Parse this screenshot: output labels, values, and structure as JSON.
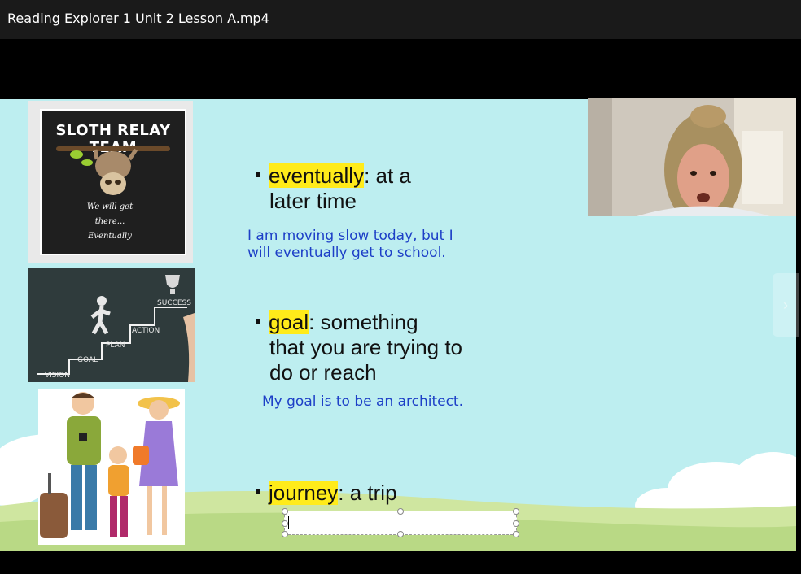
{
  "window": {
    "title": "Reading Explorer 1 Unit 2 Lesson A.mp4"
  },
  "slide": {
    "images": {
      "sloth": {
        "title": "SLOTH RELAY TEAM",
        "caption_line1": "We will get there...",
        "caption_line2": "Eventually"
      },
      "stairs": {
        "labels": [
          "VISION",
          "GOAL",
          "PLAN",
          "ACTION",
          "SUCCESS"
        ]
      }
    },
    "vocab": [
      {
        "word": "eventually",
        "definition_line1": ":   at a",
        "definition_line2": "later time",
        "example_line1": "I am moving slow today, but I",
        "example_line2": "will eventually get to school."
      },
      {
        "word": "goal",
        "definition_line1": ":  something",
        "definition_line2": "that you are trying to",
        "definition_line3": "do or reach",
        "example_line1": "My goal is to be an architect."
      },
      {
        "word": "journey",
        "definition_line1": ":  a trip"
      }
    ]
  },
  "controls": {
    "next_icon": "chevron-right-icon",
    "next_glyph": "›"
  },
  "colors": {
    "highlight": "#ffeb1a",
    "example_text": "#1d3fc7",
    "slide_bg": "#bdeef0"
  }
}
